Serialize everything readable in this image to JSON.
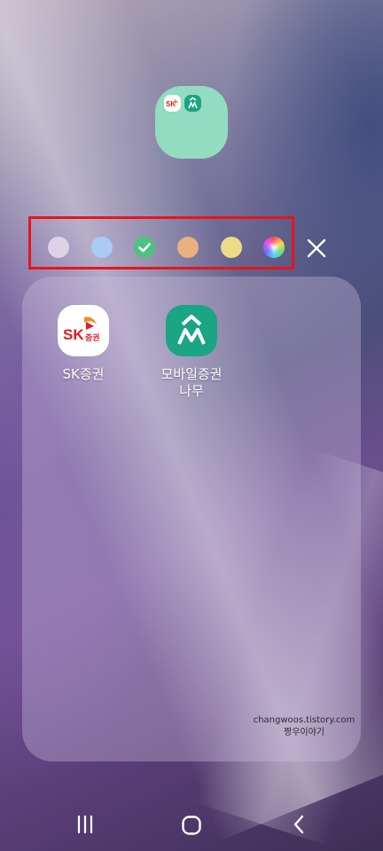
{
  "theme": {
    "accent": "#93dbc1"
  },
  "folder_preview": {
    "mini_icons": [
      "sk-securities-logo",
      "namuh-logo"
    ]
  },
  "color_picker": {
    "selected_index": 2,
    "swatches": [
      {
        "name": "lavender",
        "color": "#ddd3e6"
      },
      {
        "name": "blue",
        "color": "#a9cbf5"
      },
      {
        "name": "green",
        "color": "#4cc283"
      },
      {
        "name": "orange",
        "color": "#eab07f"
      },
      {
        "name": "yellow",
        "color": "#ecdc8a"
      },
      {
        "name": "custom-palette",
        "color": "conic-gradient"
      }
    ],
    "close_icon": "close-icon"
  },
  "apps": [
    {
      "label": "SK증권",
      "icon": "sk-securities-icon"
    },
    {
      "label": "모바일증권\n나무",
      "icon": "namuh-icon"
    }
  ],
  "watermark": {
    "line1": "changwoos.tistory.com",
    "line2": "짱우이야기"
  },
  "navbar": {
    "recent": "recent-apps-icon",
    "home": "home-icon",
    "back": "back-icon"
  }
}
